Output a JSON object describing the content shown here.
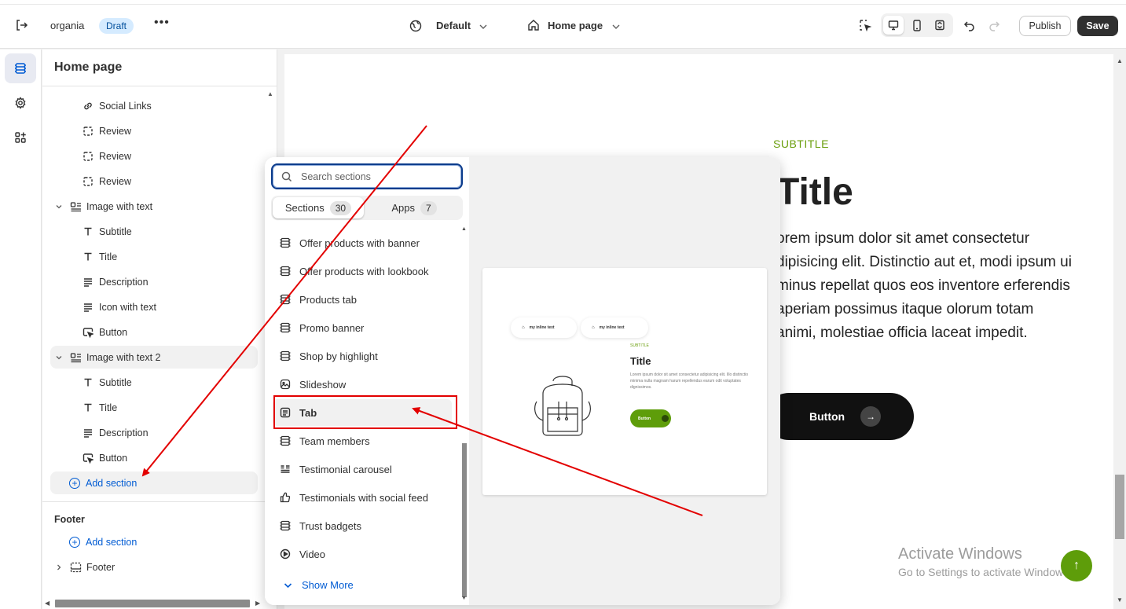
{
  "topbar": {
    "store_name": "organia",
    "status_badge": "Draft",
    "more_label": "•••",
    "theme_label": "Default",
    "page_label": "Home page",
    "publish_label": "Publish",
    "save_label": "Save"
  },
  "sidebar": {
    "title": "Home page",
    "rows": [
      {
        "label": "Social Links",
        "icon": "link-icon",
        "level": 2
      },
      {
        "label": "Review",
        "icon": "block-icon",
        "level": 2
      },
      {
        "label": "Review",
        "icon": "block-icon",
        "level": 2
      },
      {
        "label": "Review",
        "icon": "block-icon",
        "level": 2
      },
      {
        "label": "Image with text",
        "icon": "image-text-icon",
        "level": 1
      },
      {
        "label": "Subtitle",
        "icon": "text-icon",
        "level": 2
      },
      {
        "label": "Title",
        "icon": "text-icon",
        "level": 2
      },
      {
        "label": "Description",
        "icon": "lines-icon",
        "level": 2
      },
      {
        "label": "Icon with text",
        "icon": "lines-icon",
        "level": 2
      },
      {
        "label": "Button",
        "icon": "cursor-icon",
        "level": 2
      },
      {
        "label": "Image with text 2",
        "icon": "image-text-icon",
        "level": 1
      },
      {
        "label": "Subtitle",
        "icon": "text-icon",
        "level": 2
      },
      {
        "label": "Title",
        "icon": "text-icon",
        "level": 2
      },
      {
        "label": "Description",
        "icon": "lines-icon",
        "level": 2
      },
      {
        "label": "Button",
        "icon": "cursor-icon",
        "level": 2
      }
    ],
    "add_section_label": "Add section",
    "footer_group_label": "Footer",
    "footer_add_section_label": "Add section",
    "footer_item_label": "Footer"
  },
  "section_picker": {
    "search_placeholder": "Search sections",
    "tabs": [
      {
        "label": "Sections",
        "count": "30"
      },
      {
        "label": "Apps",
        "count": "7"
      }
    ],
    "items": [
      {
        "label": "Offer products with banner",
        "icon": "section-icon"
      },
      {
        "label": "Offer products with lookbook",
        "icon": "section-icon"
      },
      {
        "label": "Products tab",
        "icon": "section-icon"
      },
      {
        "label": "Promo banner",
        "icon": "section-icon"
      },
      {
        "label": "Shop by highlight",
        "icon": "section-icon"
      },
      {
        "label": "Slideshow",
        "icon": "slideshow-icon"
      },
      {
        "label": "Tab",
        "icon": "tab-icon"
      },
      {
        "label": "Team members",
        "icon": "section-icon"
      },
      {
        "label": "Testimonial carousel",
        "icon": "carousel-icon"
      },
      {
        "label": "Testimonials with social feed",
        "icon": "thumbs-up-icon"
      },
      {
        "label": "Trust badgets",
        "icon": "section-icon"
      },
      {
        "label": "Video",
        "icon": "play-icon"
      }
    ],
    "highlighted_item": "Tab",
    "show_more_label": "Show More",
    "preview_card": {
      "chip1": "my inline text",
      "chip2": "my inline text",
      "subtitle": "SUBTITLE",
      "title": "Title",
      "description": "Lorem ipsum dolor sit amet consectetur adipisicing elit. Illo distinctio minima nulla magnam harum repellendus earum odit voluptates dignissimos.",
      "button": "Button"
    }
  },
  "preview": {
    "subtitle": "SUBTITLE",
    "title": "Title",
    "description": "orem ipsum dolor sit amet consectetur dipisicing elit. Distinctio aut et, modi ipsum ui minus repellat quos eos inventore erferendis aperiam possimus itaque olorum totam animi, molestiae officia laceat impedit.",
    "button_label": "Button",
    "watermark_title": "Activate Windows",
    "watermark_sub": "Go to Settings to activate Windows."
  },
  "colors": {
    "accent_green": "#5e9d0a",
    "link_blue": "#005bd3",
    "annotation_red": "#e30000",
    "save_dark": "#303030"
  }
}
